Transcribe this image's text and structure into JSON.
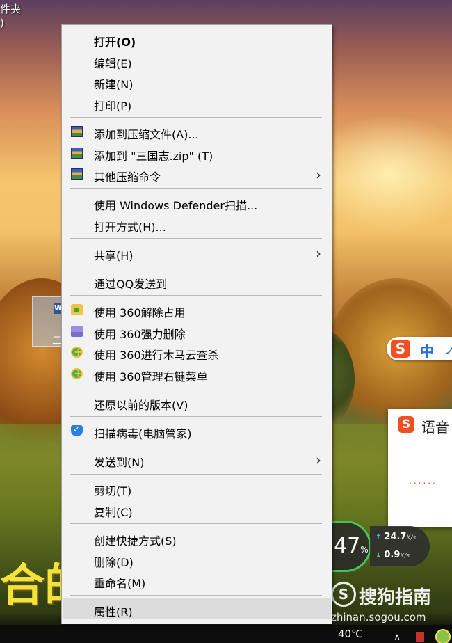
{
  "desktop": {
    "label_top": "件夹",
    "label_paren": ")",
    "file_icon_caption": "三",
    "overlay_text": "合的"
  },
  "context_menu": {
    "groups": [
      [
        {
          "label": "打开(O)",
          "bold": true
        },
        {
          "label": "编辑(E)"
        },
        {
          "label": "新建(N)"
        },
        {
          "label": "打印(P)"
        }
      ],
      [
        {
          "label": "添加到压缩文件(A)...",
          "icon": "winrar-icon"
        },
        {
          "label": "添加到 \"三国志.zip\" (T)",
          "icon": "winrar-icon"
        },
        {
          "label": "其他压缩命令",
          "icon": "winrar-icon",
          "submenu": true
        }
      ],
      [
        {
          "label": "使用 Windows Defender扫描..."
        },
        {
          "label": "打开方式(H)..."
        }
      ],
      [
        {
          "label": "共享(H)",
          "submenu": true
        }
      ],
      [
        {
          "label": "通过QQ发送到"
        }
      ],
      [
        {
          "label": "使用 360解除占用",
          "icon": "360-unlock-icon"
        },
        {
          "label": "使用 360强力删除",
          "icon": "360-shred-icon"
        },
        {
          "label": "使用 360进行木马云查杀",
          "icon": "360-scan-icon"
        },
        {
          "label": "使用 360管理右键菜单",
          "icon": "360-manage-icon"
        }
      ],
      [
        {
          "label": "还原以前的版本(V)"
        }
      ],
      [
        {
          "label": "扫描病毒(电脑管家)",
          "icon": "tencent-shield-icon"
        }
      ],
      [
        {
          "label": "发送到(N)",
          "submenu": true
        }
      ],
      [
        {
          "label": "剪切(T)"
        },
        {
          "label": "复制(C)"
        }
      ],
      [
        {
          "label": "创建快捷方式(S)"
        },
        {
          "label": "删除(D)"
        },
        {
          "label": "重命名(M)"
        }
      ],
      [
        {
          "label": "属性(R)",
          "highlighted": true
        }
      ]
    ],
    "submenu_icon": "chevron-right-icon"
  },
  "ime": {
    "logo": "S",
    "mode": "中",
    "extra": "ノ",
    "voice_title": "语音",
    "voice_status": "......"
  },
  "speed_widget": {
    "percent": "47",
    "percent_unit": "%",
    "upload": "24.7",
    "download": "0.9",
    "unit": "K/s"
  },
  "watermark": {
    "logo": "S",
    "name": "搜狗指南",
    "url": "zhinan.sogou.com"
  },
  "taskbar": {
    "temperature": "40℃",
    "tray_chevron": "∧"
  }
}
